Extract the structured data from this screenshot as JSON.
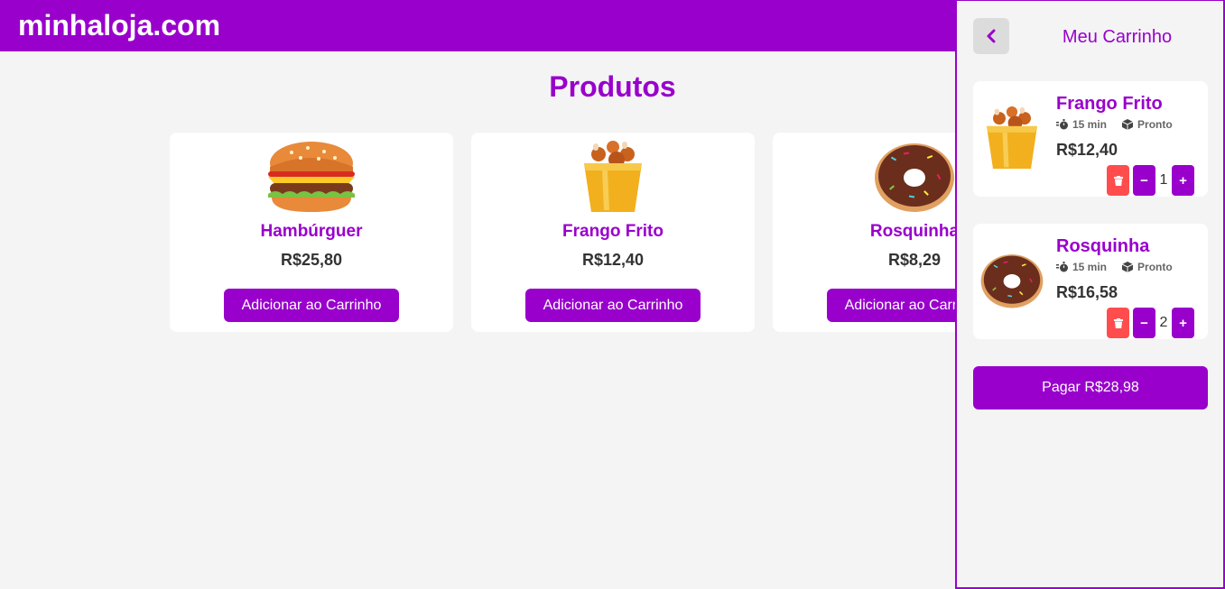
{
  "header": {
    "logo": "minhaloja.com"
  },
  "products": {
    "title": "Produtos",
    "add_label": "Adicionar ao Carrinho",
    "items": [
      {
        "name": "Hambúrguer",
        "price": "R$25,80",
        "icon": "burger-icon"
      },
      {
        "name": "Frango Frito",
        "price": "R$12,40",
        "icon": "fried-chicken-icon"
      },
      {
        "name": "Rosquinha",
        "price": "R$8,29",
        "icon": "donut-icon"
      }
    ]
  },
  "cart": {
    "title": "Meu Carrinho",
    "items": [
      {
        "name": "Frango Frito",
        "time": "15 min",
        "status": "Pronto",
        "price": "R$12,40",
        "qty": "1",
        "icon": "fried-chicken-icon"
      },
      {
        "name": "Rosquinha",
        "time": "15 min",
        "status": "Pronto",
        "price": "R$16,58",
        "qty": "2",
        "icon": "donut-icon"
      }
    ],
    "pay_label": "Pagar R$28,98"
  },
  "colors": {
    "brand": "#9900cc",
    "danger": "#ff4d4d",
    "background": "#f4f4f4"
  }
}
